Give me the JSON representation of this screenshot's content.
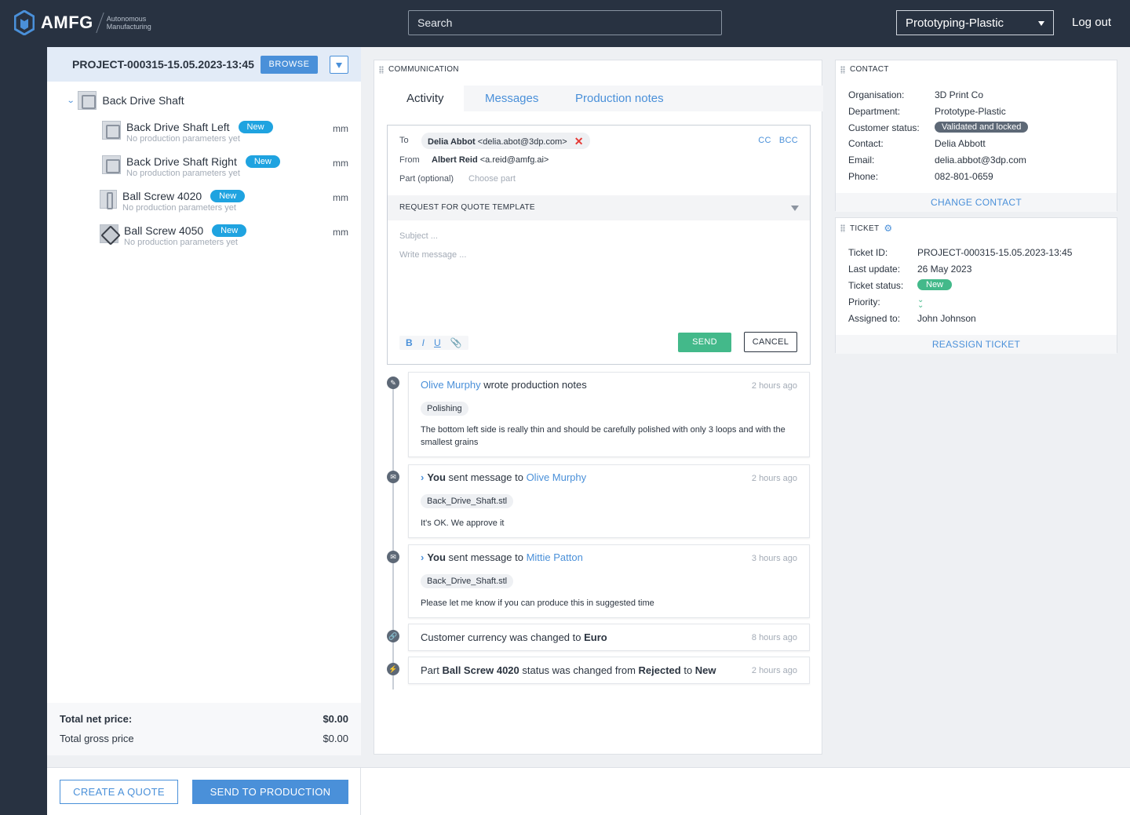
{
  "app": {
    "logo_text": "AMFG",
    "logo_sub_1": "Autonomous",
    "logo_sub_2": "Manufacturing"
  },
  "topbar": {
    "search_placeholder": "Search",
    "workspace": "Prototyping-Plastic",
    "logout": "Log out"
  },
  "project": {
    "id": "PROJECT-000315-15.05.2023-13:45",
    "browse": "BROWSE",
    "root": "Back Drive Shaft",
    "parts": [
      {
        "name": "Back Drive Shaft Left",
        "status": "New",
        "sub": "No production parameters yet",
        "unit": "mm"
      },
      {
        "name": "Back Drive Shaft Right",
        "status": "New",
        "sub": "No production parameters yet",
        "unit": "mm"
      },
      {
        "name": "Ball Screw 4020",
        "status": "New",
        "sub": "No production parameters yet",
        "unit": "mm"
      },
      {
        "name": "Ball Screw 4050",
        "status": "New",
        "sub": "No production parameters yet",
        "unit": "mm"
      }
    ],
    "totals": {
      "net_label": "Total net price:",
      "net_value": "$0.00",
      "gross_label": "Total gross price",
      "gross_value": "$0.00"
    }
  },
  "actions": {
    "create_quote": "CREATE A QUOTE",
    "send_production": "SEND TO PRODUCTION"
  },
  "communication": {
    "label": "COMMUNICATION",
    "tabs": [
      "Activity",
      "Messages",
      "Production notes"
    ],
    "compose": {
      "to_label": "To",
      "to_name": "Delia Abbot",
      "to_email": "<delia.abot@3dp.com>",
      "cc": "CC",
      "bcc": "BCC",
      "from_label": "From",
      "from_name": "Albert Reid",
      "from_email": "<a.reid@amfg.ai>",
      "part_label": "Part (optional)",
      "part_placeholder": "Choose part",
      "template": "REQUEST FOR QUOTE TEMPLATE",
      "subject_placeholder": "Subject ...",
      "message_placeholder": "Write message ...",
      "send": "SEND",
      "cancel": "CANCEL"
    },
    "activity": [
      {
        "actor": "Olive Murphy",
        "action": " wrote production notes",
        "time": "2 hours ago",
        "tag": "Polishing",
        "body": "The bottom left side is really thin and should be carefully polished with only 3 loops and with the smallest grains"
      },
      {
        "actor": "You",
        "action": " sent message to ",
        "target": "Olive Murphy",
        "time": "2 hours ago",
        "tag": "Back_Drive_Shaft.stl",
        "body": "It's OK. We approve it"
      },
      {
        "actor": "You",
        "action": " sent message to ",
        "target": "Mittie Patton",
        "time": "3 hours ago",
        "tag": "Back_Drive_Shaft.stl",
        "body": "Please let me know if you can produce this in suggested time"
      },
      {
        "text": "Customer currency was changed to ",
        "bold": "Euro",
        "time": "8 hours ago"
      },
      {
        "pre": "Part ",
        "part": "Ball Screw 4020",
        "mid": " status was changed from ",
        "from": "Rejected",
        "to_word": " to ",
        "to": "New",
        "time": "2 hours ago"
      }
    ]
  },
  "contact": {
    "label": "CONTACT",
    "organisation_label": "Organisation:",
    "organisation": "3D Print Co",
    "department_label": "Department:",
    "department": "Prototype-Plastic",
    "status_label": "Customer status:",
    "status": "Validated and locked",
    "contact_label": "Contact:",
    "contact": "Delia Abbott",
    "email_label": "Email:",
    "email": "delia.abbot@3dp.com",
    "phone_label": "Phone:",
    "phone": "082-801-0659",
    "change": "CHANGE CONTACT"
  },
  "ticket": {
    "label": "TICKET",
    "id_label": "Ticket ID:",
    "id": "PROJECT-000315-15.05.2023-13:45",
    "update_label": "Last update:",
    "update": "26 May 2023",
    "status_label": "Ticket status:",
    "status": "New",
    "priority_label": "Priority:",
    "assigned_label": "Assigned to:",
    "assigned": "John Johnson",
    "reassign": "REASSIGN TICKET"
  },
  "colors": {
    "nav": "#283241",
    "accent": "#4a90d9",
    "success": "#43b98a",
    "badge_blue": "#1fa3e0",
    "danger": "#e53935"
  }
}
